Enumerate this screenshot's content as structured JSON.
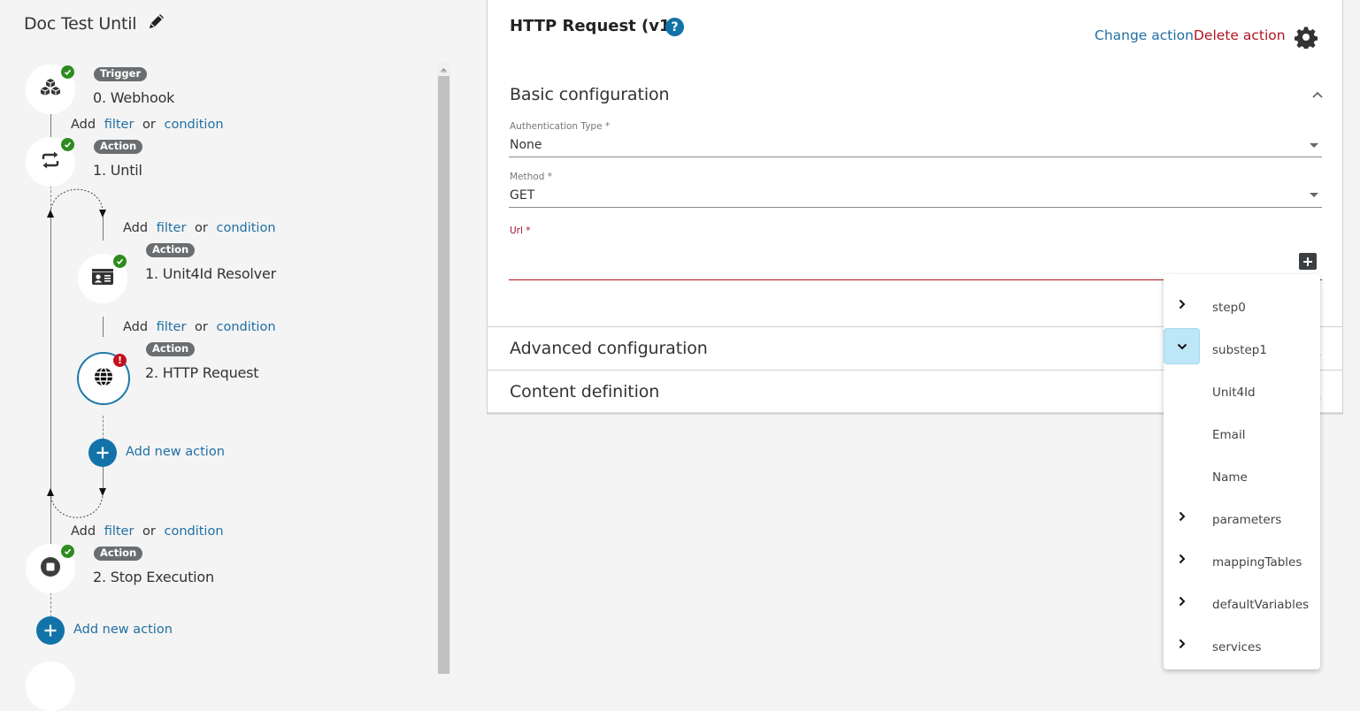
{
  "flow": {
    "title": "Doc Test Until",
    "steps": [
      {
        "tag": "Trigger",
        "name": "0. Webhook",
        "icon": "cubes-icon",
        "status": "ok"
      },
      {
        "tag": "Action",
        "name": "1. Until",
        "icon": "loop-icon",
        "status": "ok"
      },
      {
        "tag": "Action",
        "name": "1. Unit4Id Resolver",
        "icon": "id-card-icon",
        "status": "ok"
      },
      {
        "tag": "Action",
        "name": "2. HTTP Request",
        "icon": "globe-icon",
        "status": "error"
      },
      {
        "tag": "Action",
        "name": "2. Stop Execution",
        "icon": "stop-icon",
        "status": "ok"
      }
    ],
    "add_filter": {
      "prefix": "Add",
      "filter": "filter",
      "or": "or",
      "condition": "condition"
    },
    "add_new_action": "Add new action",
    "error_badge": "!"
  },
  "panel": {
    "title": "HTTP Request (v1)",
    "help": "?",
    "change_action": "Change action",
    "delete_action": "Delete action",
    "sections": {
      "basic": "Basic configuration",
      "advanced": "Advanced configuration",
      "content": "Content definition"
    },
    "fields": {
      "auth": {
        "label": "Authentication Type *",
        "value": "None"
      },
      "method": {
        "label": "Method *",
        "value": "GET"
      },
      "url": {
        "label": "Url *",
        "value": ""
      }
    }
  },
  "dropdown": {
    "items": [
      {
        "label": "step0",
        "expander": "collapsed"
      },
      {
        "label": "substep1",
        "expander": "expanded"
      },
      {
        "label": "Unit4Id",
        "expander": "none"
      },
      {
        "label": "Email",
        "expander": "none"
      },
      {
        "label": "Name",
        "expander": "none"
      },
      {
        "label": "parameters",
        "expander": "collapsed"
      },
      {
        "label": "mappingTables",
        "expander": "collapsed"
      },
      {
        "label": "defaultVariables",
        "expander": "collapsed"
      },
      {
        "label": "services",
        "expander": "collapsed"
      }
    ]
  },
  "colors": {
    "accent": "#1273a8",
    "link": "#1f6fa3",
    "danger": "#b3141f",
    "success": "#2e8b1f",
    "tag_bg": "#6b6e70",
    "selected_toggle": "#bde6f6"
  }
}
